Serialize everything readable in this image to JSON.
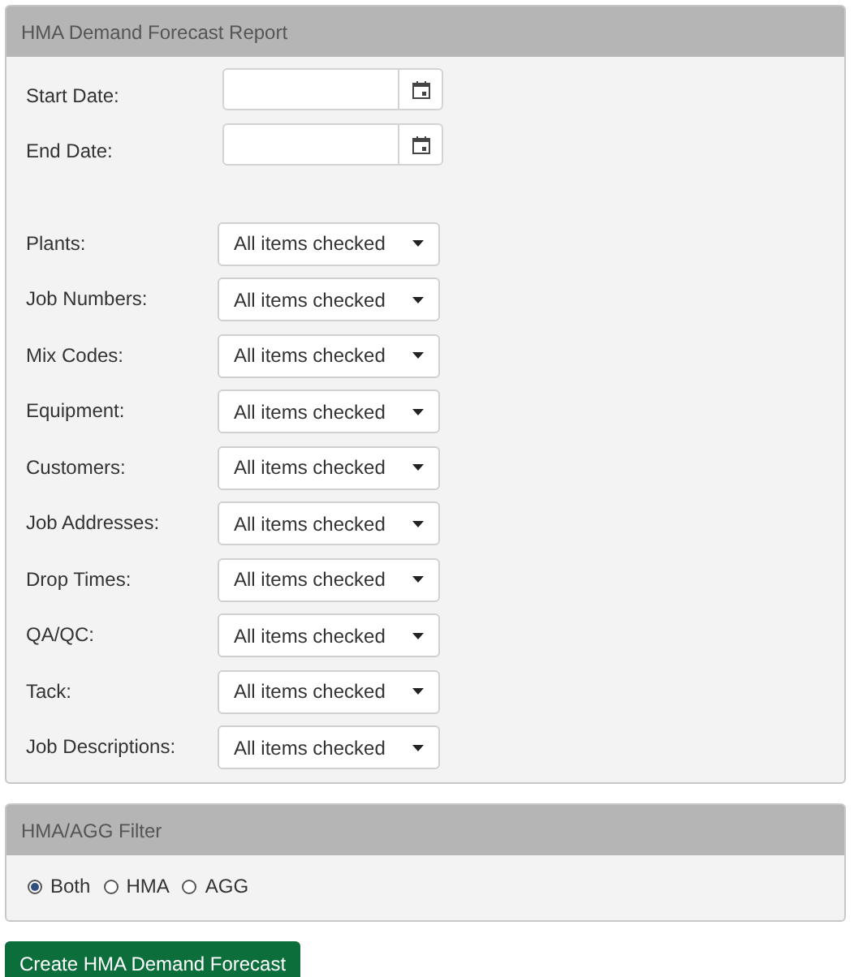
{
  "report_panel": {
    "title": "HMA Demand Forecast Report",
    "dates": [
      {
        "label": "Start Date:"
      },
      {
        "label": "End Date:"
      }
    ],
    "filters": [
      {
        "label": "Plants:",
        "value": "All items checked"
      },
      {
        "label": "Job Numbers:",
        "value": "All items checked"
      },
      {
        "label": "Mix Codes:",
        "value": "All items checked"
      },
      {
        "label": "Equipment:",
        "value": "All items checked"
      },
      {
        "label": "Customers:",
        "value": "All items checked"
      },
      {
        "label": "Job Addresses:",
        "value": "All items checked"
      },
      {
        "label": "Drop Times:",
        "value": "All items checked"
      },
      {
        "label": "QA/QC:",
        "value": "All items checked"
      },
      {
        "label": "Tack:",
        "value": "All items checked"
      },
      {
        "label": "Job Descriptions:",
        "value": "All items checked"
      }
    ]
  },
  "filter_panel": {
    "title": "HMA/AGG Filter",
    "options": [
      {
        "label": "Both",
        "selected": true
      },
      {
        "label": "HMA",
        "selected": false
      },
      {
        "label": "AGG",
        "selected": false
      }
    ]
  },
  "submit_button": "Create HMA Demand Forecast"
}
